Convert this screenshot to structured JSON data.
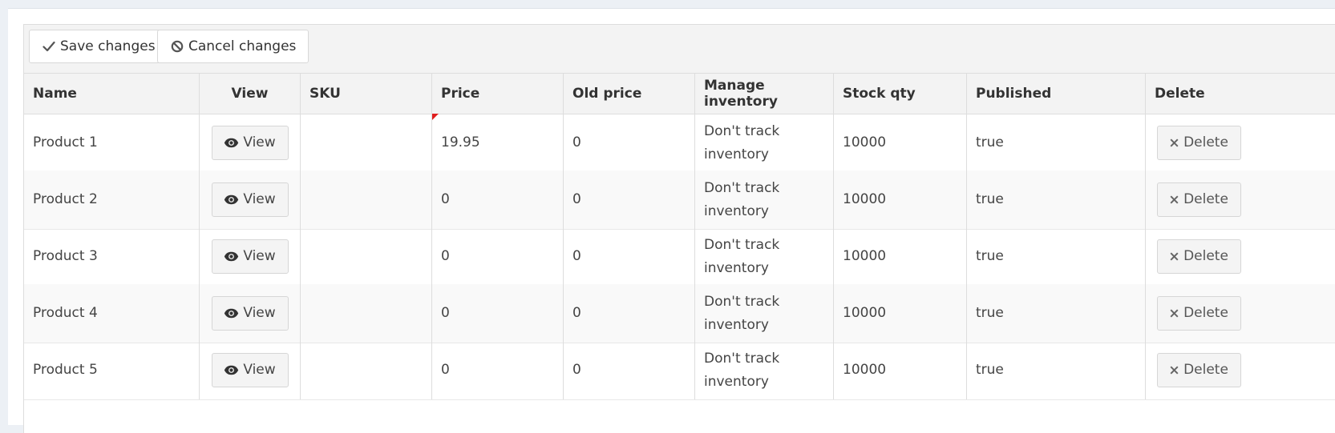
{
  "toolbar": {
    "save_label": "Save changes",
    "cancel_label": "Cancel changes"
  },
  "columns": [
    "Name",
    "View",
    "SKU",
    "Price",
    "Old price",
    "Manage inventory",
    "Stock qty",
    "Published",
    "Delete"
  ],
  "rows": [
    {
      "name": "Product 1",
      "view_label": "View",
      "sku": "",
      "price": "19.95",
      "old_price": "0",
      "manage_inventory": "Don't track inventory",
      "stock_qty": "10000",
      "published": "true",
      "delete_label": "Delete",
      "price_edited": true
    },
    {
      "name": "Product 2",
      "view_label": "View",
      "sku": "",
      "price": "0",
      "old_price": "0",
      "manage_inventory": "Don't track inventory",
      "stock_qty": "10000",
      "published": "true",
      "delete_label": "Delete",
      "price_edited": false
    },
    {
      "name": "Product 3",
      "view_label": "View",
      "sku": "",
      "price": "0",
      "old_price": "0",
      "manage_inventory": "Don't track inventory",
      "stock_qty": "10000",
      "published": "true",
      "delete_label": "Delete",
      "price_edited": false
    },
    {
      "name": "Product 4",
      "view_label": "View",
      "sku": "",
      "price": "0",
      "old_price": "0",
      "manage_inventory": "Don't track inventory",
      "stock_qty": "10000",
      "published": "true",
      "delete_label": "Delete",
      "price_edited": false
    },
    {
      "name": "Product 5",
      "view_label": "View",
      "sku": "",
      "price": "0",
      "old_price": "0",
      "manage_inventory": "Don't track inventory",
      "stock_qty": "10000",
      "published": "true",
      "delete_label": "Delete",
      "price_edited": false
    }
  ],
  "icons": {
    "save": "check-icon",
    "cancel": "ban-icon",
    "view": "eye-icon",
    "delete": "times-icon"
  },
  "colors": {
    "dirty_flag": "#e01e1e",
    "header_bg": "#f3f3f3"
  }
}
